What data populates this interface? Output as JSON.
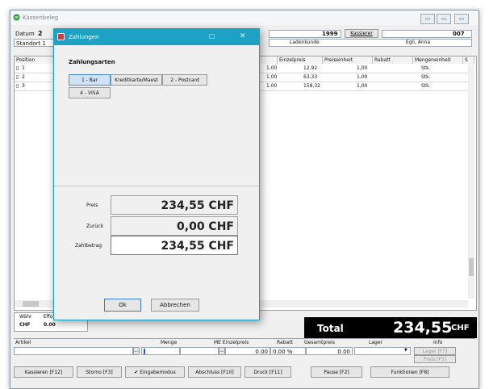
{
  "window": {
    "title": "Kassenbeleg",
    "min": "▭",
    "max": "▭",
    "close": "▭"
  },
  "header": {
    "datum_label": "Datum",
    "datum_value": "2",
    "standort_label": "Standort 1",
    "number": "1999",
    "kassierer_button": "Kassierer",
    "kassierer_code": "007",
    "ladenkunde": "Ladenkunde",
    "customer": "Egli, Anna"
  },
  "grid": {
    "columns": [
      "Position",
      "",
      "Einzelpreis",
      "Preiseinheit",
      "Rabatt",
      "Mengeneinheit",
      "S"
    ],
    "rows": [
      {
        "pos": "1",
        "qty": "1.00",
        "price": "12,92",
        "unit": "1,00",
        "rabatt": "",
        "me": "Stk."
      },
      {
        "pos": "2",
        "qty": "1.00",
        "price": "63,33",
        "unit": "1,00",
        "rabatt": "",
        "me": "Stk."
      },
      {
        "pos": "3",
        "qty": "1.00",
        "price": "158,32",
        "unit": "1,00",
        "rabatt": "",
        "me": "Stk."
      }
    ]
  },
  "dialog": {
    "title": "Zahlungen",
    "section": "Zahlungsarten",
    "methods": [
      "1 - Bar",
      "Kreditkarte/Maest",
      "2 - Postcard",
      "4 - VISA"
    ],
    "preis_label": "Preis",
    "preis_value": "234,55 CHF",
    "zurueck_label": "Zurück",
    "zurueck_value": "0,00 CHF",
    "zahlbetrag_label": "Zahlbetrag",
    "zahlbetrag_value": "234,55 CHF",
    "ok": "Ok",
    "cancel": "Abbrechen",
    "max": "☐",
    "close": "✕"
  },
  "summary": {
    "waehr": "Währ",
    "effort": "Effort",
    "chf": "CHF",
    "zero": "0.00",
    "total_label": "Total",
    "total_value": "234,55",
    "total_currency": "CHF"
  },
  "entry": {
    "headers": [
      "Artikel",
      "Menge",
      "ME Einzelpreis",
      "Rabatt",
      "Gesamtpreis",
      "Lager",
      "Info"
    ],
    "einzelpreis": "0.00",
    "rabatt": "0.00 %",
    "gesamt": "0.00",
    "lager_btn": "Lager [F7]",
    "preis_btn": "Preis [F5]"
  },
  "footer": [
    "Kassieren [F12]",
    "Storno [F3]",
    "✔ Eingabemodus",
    "Abschluss [F10]",
    "Druck [F11]",
    "Pause [F2]",
    "Funktionen [F8]"
  ],
  "colors": {
    "accent": "#1ea2c4",
    "total_bg": "#000000"
  }
}
